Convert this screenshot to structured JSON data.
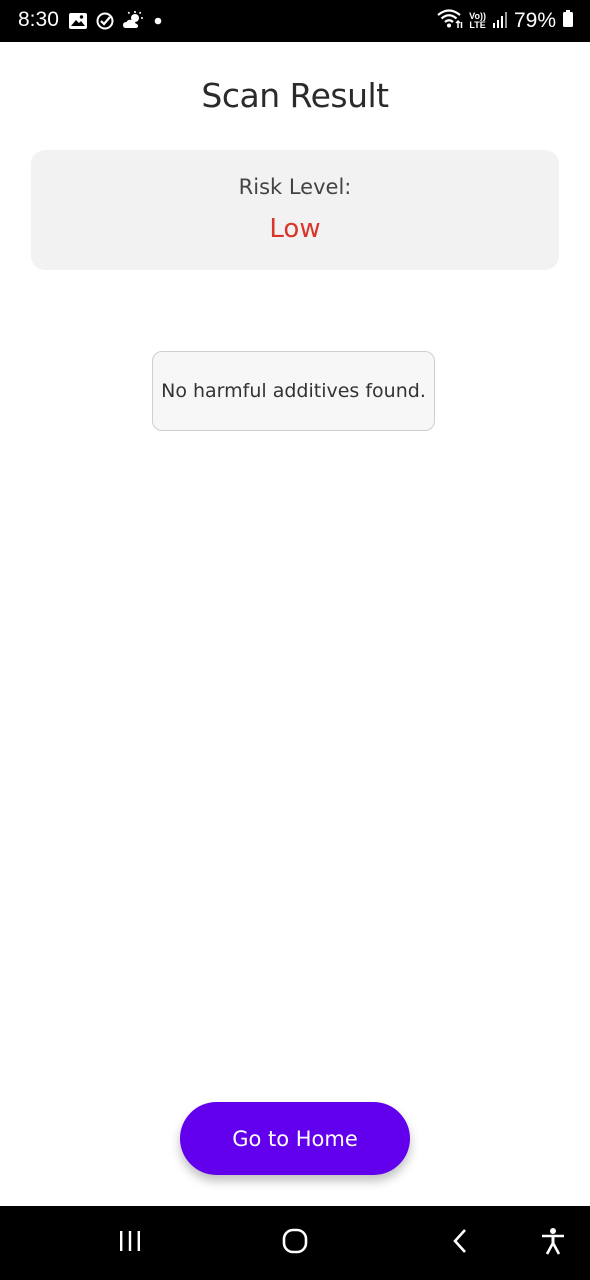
{
  "status_bar": {
    "time": "8:30",
    "battery": "79%",
    "network_label_top": "Vo))",
    "network_label_bottom": "LTE",
    "icons": [
      "image-icon",
      "check-circle-icon",
      "weather-icon",
      "dot-icon",
      "wifi-icon",
      "signal-icon",
      "battery-icon"
    ]
  },
  "page": {
    "title": "Scan Result"
  },
  "risk": {
    "label": "Risk Level:",
    "value": "Low",
    "value_color": "#d9352b"
  },
  "message": {
    "text": "No harmful additives found."
  },
  "actions": {
    "home_label": "Go to Home",
    "accent": "#6200ee"
  },
  "nav_bar": {
    "icons": [
      "recent-apps-icon",
      "home-icon",
      "back-icon",
      "accessibility-icon"
    ]
  }
}
